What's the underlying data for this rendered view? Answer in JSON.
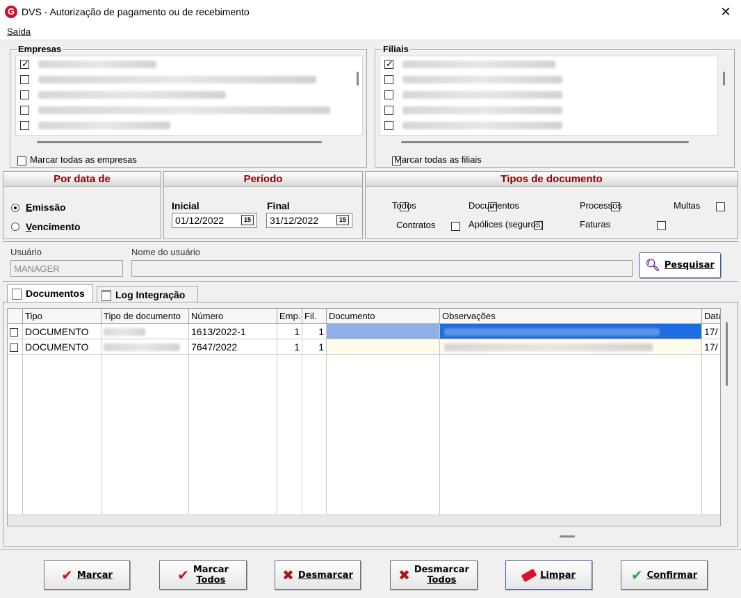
{
  "window": {
    "title": "DVS - Autorização de pagamento ou de recebimento",
    "close_label": "✕"
  },
  "menu": {
    "saida_label": "Saída"
  },
  "empresas": {
    "legend": "Empresas",
    "items": [
      {
        "checked": true
      },
      {
        "checked": false
      },
      {
        "checked": false
      },
      {
        "checked": false
      },
      {
        "checked": false
      }
    ],
    "mark_all_label": "Marcar todas as empresas"
  },
  "filiais": {
    "legend": "Filiais",
    "items": [
      {
        "checked": true
      },
      {
        "checked": false
      },
      {
        "checked": false
      },
      {
        "checked": false
      },
      {
        "checked": false
      }
    ],
    "mark_all_label": "Marcar todas as filiais"
  },
  "por_data": {
    "title": "Por data de",
    "options": [
      {
        "label": "Emissão",
        "selected": true
      },
      {
        "label": "Vencimento",
        "selected": false
      }
    ]
  },
  "periodo": {
    "title": "Período",
    "inicial_label": "Inicial",
    "inicial_value": "01/12/2022",
    "final_label": "Final",
    "final_value": "31/12/2022",
    "calendar_glyph": "15"
  },
  "tipos": {
    "title": "Tipos de documento",
    "options": [
      {
        "label": "Todos",
        "checked": false
      },
      {
        "label": "Documentos",
        "checked": true
      },
      {
        "label": "Processos",
        "checked": false
      },
      {
        "label": "Multas",
        "checked": false
      },
      {
        "label": "Contratos",
        "checked": false
      },
      {
        "label": "Apólices (seguros)",
        "checked": false
      },
      {
        "label": "Faturas",
        "checked": false
      }
    ]
  },
  "usuario": {
    "usuario_label": "Usuário",
    "usuario_value": "MANAGER",
    "nome_label": "Nome do usuário",
    "nome_value": "",
    "pesquisar_label": "Pesquisar"
  },
  "tabs": [
    {
      "label": "Documentos",
      "active": true
    },
    {
      "label": "Log Integração",
      "active": false
    }
  ],
  "grid": {
    "columns": [
      "Tipo",
      "Tipo de documento",
      "Número",
      "Emp.",
      "Fil.",
      "Documento",
      "Observações",
      "Data"
    ],
    "rows": [
      {
        "checked": false,
        "tipo": "DOCUMENTO",
        "numero": "1613/2022-1",
        "emp": "1",
        "fil": "1",
        "data": "17/"
      },
      {
        "checked": false,
        "tipo": "DOCUMENTO",
        "numero": "7647/2022",
        "emp": "1",
        "fil": "1",
        "data": "17/"
      }
    ]
  },
  "buttons": {
    "marcar": "Marcar",
    "marcar_todos_1": "Marcar",
    "marcar_todos_2": "Todos",
    "desmarcar": "Desmarcar",
    "desmarcar_todos_1": "Desmarcar",
    "desmarcar_todos_2": "Todos",
    "limpar": "Limpar",
    "confirmar": "Confirmar"
  },
  "colors": {
    "header_red": "#8b0000",
    "selection_blue": "#8fb0e8",
    "check_red": "#d01010",
    "check_green": "#2aa84a"
  }
}
